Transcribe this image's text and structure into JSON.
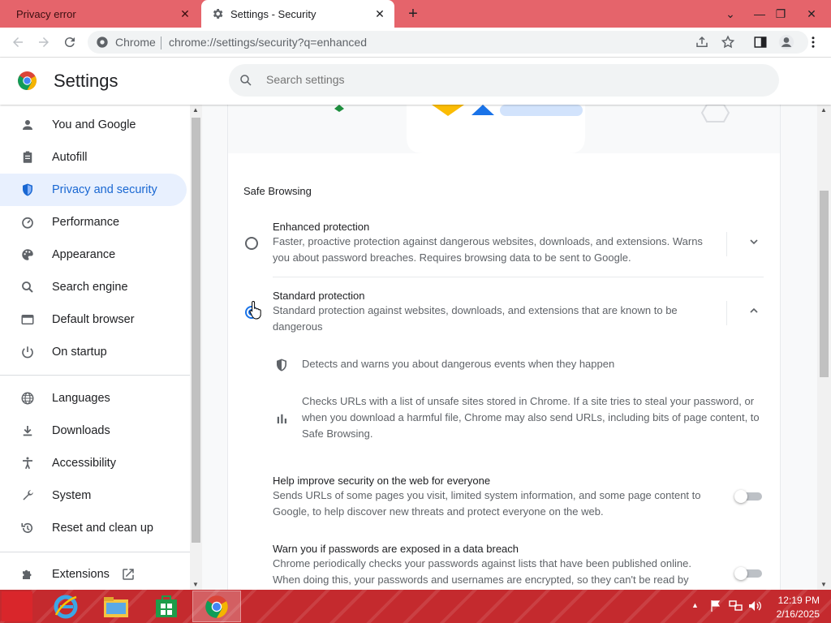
{
  "tabs": [
    {
      "title": "Privacy error",
      "active": false
    },
    {
      "title": "Settings - Security",
      "active": true
    }
  ],
  "omnibox": {
    "site_label": "Chrome",
    "url": "chrome://settings/security?q=enhanced"
  },
  "settings": {
    "title": "Settings",
    "search_placeholder": "Search settings"
  },
  "sidebar": {
    "items": [
      {
        "label": "You and Google",
        "icon": "person-icon"
      },
      {
        "label": "Autofill",
        "icon": "clipboard-icon"
      },
      {
        "label": "Privacy and security",
        "icon": "shield-icon",
        "active": true
      },
      {
        "label": "Performance",
        "icon": "speedometer-icon"
      },
      {
        "label": "Appearance",
        "icon": "palette-icon"
      },
      {
        "label": "Search engine",
        "icon": "search-icon"
      },
      {
        "label": "Default browser",
        "icon": "browser-icon"
      },
      {
        "label": "On startup",
        "icon": "power-icon"
      },
      {
        "label": "Languages",
        "icon": "globe-icon"
      },
      {
        "label": "Downloads",
        "icon": "download-icon"
      },
      {
        "label": "Accessibility",
        "icon": "accessibility-icon"
      },
      {
        "label": "System",
        "icon": "wrench-icon"
      },
      {
        "label": "Reset and clean up",
        "icon": "history-icon"
      },
      {
        "label": "Extensions",
        "icon": "puzzle-icon"
      }
    ]
  },
  "safe_browsing": {
    "section_title": "Safe Browsing",
    "enhanced": {
      "title": "Enhanced protection",
      "desc": "Faster, proactive protection against dangerous websites, downloads, and extensions. Warns you about password breaches. Requires browsing data to be sent to Google.",
      "selected": false
    },
    "standard": {
      "title": "Standard protection",
      "desc": "Standard protection against websites, downloads, and extensions that are known to be dangerous",
      "selected": true,
      "details": [
        {
          "icon": "shield-icon",
          "text": "Detects and warns you about dangerous events when they happen"
        },
        {
          "icon": "bar-chart-icon",
          "text": "Checks URLs with a list of unsafe sites stored in Chrome. If a site tries to steal your password, or when you download a harmful file, Chrome may also send URLs, including bits of page content, to Safe Browsing."
        }
      ]
    },
    "help_improve": {
      "title": "Help improve security on the web for everyone",
      "desc": "Sends URLs of some pages you visit, limited system information, and some page content to Google, to help discover new threats and protect everyone on the web.",
      "enabled": false
    },
    "password_warn": {
      "title": "Warn you if passwords are exposed in a data breach",
      "desc": "Chrome periodically checks your passwords against lists that have been published online. When doing this, your passwords and usernames are encrypted, so they can't be read by",
      "enabled": false
    }
  },
  "taskbar": {
    "time": "12:19 PM",
    "date": "2/16/2025"
  },
  "colors": {
    "accent": "#1a73e8",
    "tabstrip": "#e5646b",
    "taskbar": "#c42a2e"
  }
}
